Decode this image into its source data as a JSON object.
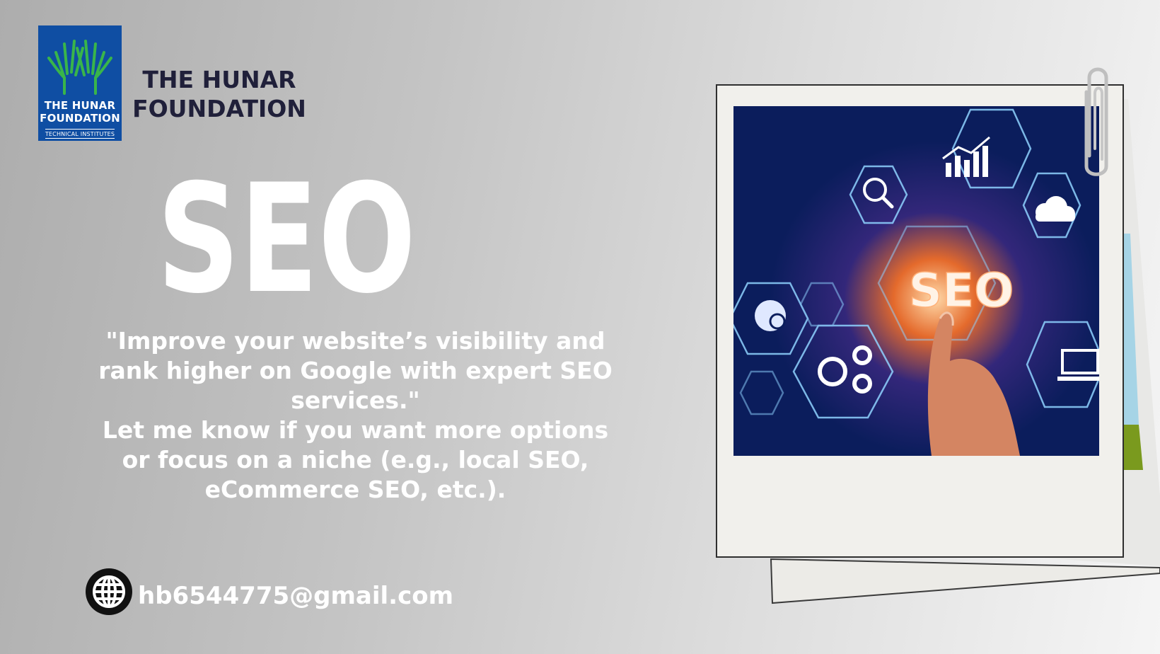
{
  "logo": {
    "line1": "THE HUNAR",
    "line2": "FOUNDATION",
    "subtitle": "TECHNICAL INSTITUTES",
    "icon": "raised-hands-icon",
    "bg_color": "#0f4ea3",
    "hands_color": "#39b54a"
  },
  "brand": {
    "line1": "THE HUNAR",
    "line2": "FOUNDATION",
    "color": "#20203a"
  },
  "hero": {
    "title": "SEO"
  },
  "description": {
    "quote": "\"Improve your website’s visibility and rank higher on Google with expert SEO services.\"",
    "note": "Let me know if you want more options or focus on a niche (e.g., local SEO, eCommerce SEO, etc.)."
  },
  "contact": {
    "icon": "globe-icon",
    "email": "hb6544775@gmail.com"
  },
  "photo": {
    "icon": "seo-hexagon-illustration",
    "overlay_text": "SEO",
    "clip_icon": "paperclip-icon"
  }
}
